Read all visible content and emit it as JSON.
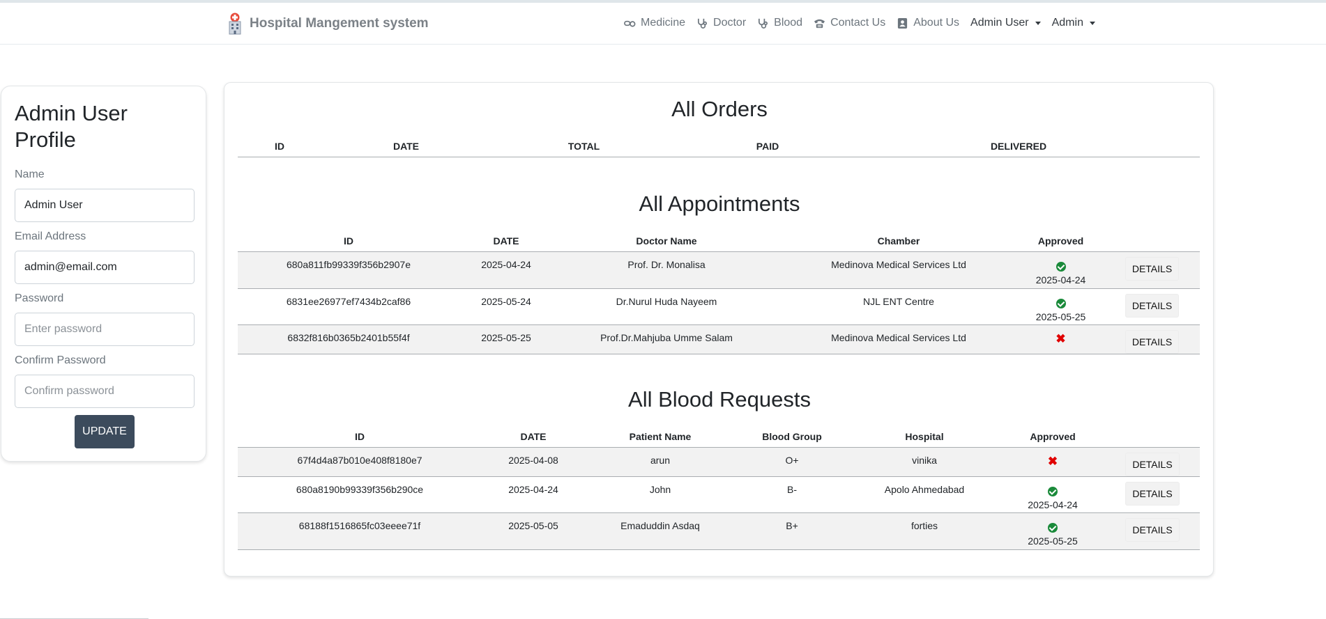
{
  "brand": {
    "title": "Hospital Mangement system"
  },
  "nav": {
    "medicine": "Medicine",
    "doctor": "Doctor",
    "blood": "Blood",
    "contact": "Contact Us",
    "about": "About Us",
    "admin_user": "Admin User",
    "admin": "Admin"
  },
  "profile": {
    "title": "Admin User Profile",
    "name_label": "Name",
    "name_value": "Admin User",
    "email_label": "Email Address",
    "email_value": "admin@email.com",
    "password_label": "Password",
    "password_placeholder": "Enter password",
    "confirm_label": "Confirm Password",
    "confirm_placeholder": "Confirm password",
    "update_label": "UPDATE"
  },
  "orders": {
    "title": "All Orders",
    "headers": [
      "ID",
      "DATE",
      "TOTAL",
      "PAID",
      "DELIVERED"
    ]
  },
  "appointments": {
    "title": "All Appointments",
    "headers": [
      "ID",
      "DATE",
      "Doctor Name",
      "Chamber",
      "Approved"
    ],
    "details_label": "DETAILS",
    "rows": [
      {
        "id": "680a811fb99339f356b2907e",
        "date": "2025-04-24",
        "doctor": "Prof. Dr. Monalisa",
        "chamber": "Medinova Medical Services Ltd",
        "approved": true,
        "approved_date": "2025-04-24"
      },
      {
        "id": "6831ee26977ef7434b2caf86",
        "date": "2025-05-24",
        "doctor": "Dr.Nurul Huda Nayeem",
        "chamber": "NJL ENT Centre",
        "approved": true,
        "approved_date": "2025-05-25"
      },
      {
        "id": "6832f816b0365b2401b55f4f",
        "date": "2025-05-25",
        "doctor": "Prof.Dr.Mahjuba Umme Salam",
        "chamber": "Medinova Medical Services Ltd",
        "approved": false,
        "approved_date": ""
      }
    ]
  },
  "blood": {
    "title": "All Blood Requests",
    "headers": [
      "ID",
      "DATE",
      "Patient Name",
      "Blood Group",
      "Hospital",
      "Approved"
    ],
    "details_label": "DETAILS",
    "rows": [
      {
        "id": "67f4d4a87b010e408f8180e7",
        "date": "2025-04-08",
        "patient": "arun",
        "group": "O+",
        "hospital": "vinika",
        "approved": false,
        "approved_date": ""
      },
      {
        "id": "680a8190b99339f356b290ce",
        "date": "2025-04-24",
        "patient": "John",
        "group": "B-",
        "hospital": "Apolo Ahmedabad",
        "approved": true,
        "approved_date": "2025-04-24"
      },
      {
        "id": "68188f1516865fc03eeee71f",
        "date": "2025-05-05",
        "patient": "Emaduddin Asdaq",
        "group": "B+",
        "hospital": "forties",
        "approved": true,
        "approved_date": "2025-05-25"
      }
    ]
  },
  "colors": {
    "approved": "#1a8a3a",
    "rejected": "#e00000",
    "update_button": "#3c4b5c"
  },
  "icons": [
    "hospital-logo-icon",
    "pills-icon",
    "stethoscope-icon",
    "telephone-icon",
    "contact-card-icon",
    "check-icon",
    "cross-icon"
  ]
}
